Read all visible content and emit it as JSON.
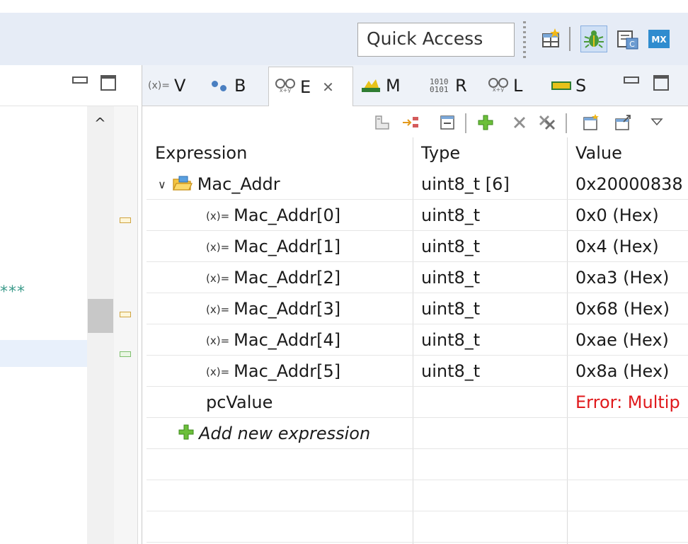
{
  "toolbar": {
    "quick_access_placeholder": "Quick Access",
    "icons": [
      "open-perspective-icon",
      "debug-perspective-icon",
      "cpp-perspective-icon",
      "cubemx-perspective-icon"
    ],
    "mx_label": "MX"
  },
  "left_panel": {
    "text_fragment": "***"
  },
  "tabs": [
    {
      "icon": "variables-icon",
      "prefix": "(x)=",
      "label": "V"
    },
    {
      "icon": "breakpoints-icon",
      "label": "B"
    },
    {
      "icon": "expressions-icon",
      "label": "E",
      "active": true
    },
    {
      "icon": "memory-icon",
      "label": "M"
    },
    {
      "icon": "registers-icon",
      "binary": "1010\n0101",
      "label": "R"
    },
    {
      "icon": "live-expressions-icon",
      "label": "L"
    },
    {
      "icon": "sfr-icon",
      "label": "S"
    }
  ],
  "table": {
    "columns": [
      "Expression",
      "Type",
      "Value"
    ],
    "root": {
      "expression": "Mac_Addr",
      "type": "uint8_t [6]",
      "value": "0x20000838"
    },
    "children": [
      {
        "prefix": "(x)=",
        "expression": "Mac_Addr[0]",
        "type": "uint8_t",
        "value": "0x0 (Hex)"
      },
      {
        "prefix": "(x)=",
        "expression": "Mac_Addr[1]",
        "type": "uint8_t",
        "value": "0x4 (Hex)"
      },
      {
        "prefix": "(x)=",
        "expression": "Mac_Addr[2]",
        "type": "uint8_t",
        "value": "0xa3 (Hex)"
      },
      {
        "prefix": "(x)=",
        "expression": "Mac_Addr[3]",
        "type": "uint8_t",
        "value": "0x68 (Hex)"
      },
      {
        "prefix": "(x)=",
        "expression": "Mac_Addr[4]",
        "type": "uint8_t",
        "value": "0xae (Hex)"
      },
      {
        "prefix": "(x)=",
        "expression": "Mac_Addr[5]",
        "type": "uint8_t",
        "value": "0x8a (Hex)"
      }
    ],
    "error_row": {
      "expression": "pcValue",
      "type": "",
      "value": "Error: Multip"
    },
    "add_row": {
      "label": "Add new expression"
    }
  },
  "colors": {
    "toolbar_bg": "#e6ecf6",
    "error_text": "#e0191c",
    "add_icon": "#4caf30"
  }
}
